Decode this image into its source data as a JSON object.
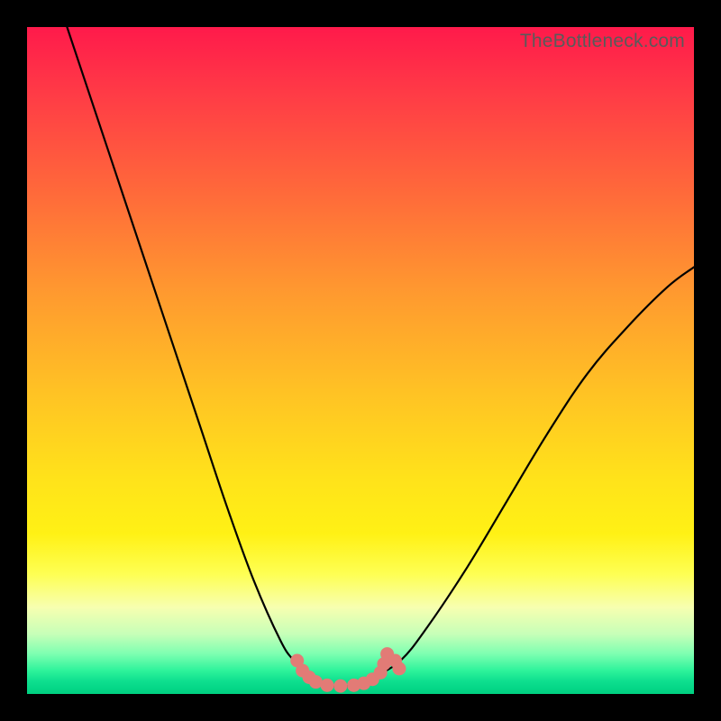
{
  "watermark": "TheBottleneck.com",
  "chart_data": {
    "type": "line",
    "title": "",
    "xlabel": "",
    "ylabel": "",
    "xlim": [
      0,
      100
    ],
    "ylim": [
      0,
      100
    ],
    "grid": false,
    "legend": false,
    "series": [
      {
        "name": "left-branch",
        "x": [
          6,
          10,
          14,
          18,
          22,
          26,
          30,
          34,
          38,
          40,
          42
        ],
        "values": [
          100,
          88,
          76,
          64,
          52,
          40,
          28,
          17,
          8,
          5,
          3
        ]
      },
      {
        "name": "trough",
        "x": [
          42,
          44,
          46,
          48,
          50,
          52
        ],
        "values": [
          3,
          1.5,
          1.2,
          1.2,
          1.5,
          2.5
        ]
      },
      {
        "name": "right-branch",
        "x": [
          52,
          56,
          60,
          66,
          72,
          78,
          84,
          90,
          96,
          100
        ],
        "values": [
          2.5,
          5,
          10,
          19,
          29,
          39,
          48,
          55,
          61,
          64
        ]
      }
    ],
    "trough_markers": {
      "name": "trough-dots",
      "x": [
        40.5,
        41.3,
        42.3,
        43.3,
        45,
        47,
        49,
        50.5,
        51.8,
        53,
        53.5,
        54.0,
        55.2,
        55.8
      ],
      "values": [
        5.0,
        3.5,
        2.5,
        1.8,
        1.3,
        1.2,
        1.3,
        1.6,
        2.2,
        3.2,
        4.5,
        6.0,
        5.0,
        3.8
      ]
    },
    "background_gradient": {
      "top": "#ff1a4b",
      "upper_mid": "#ffa829",
      "lower_mid": "#fff030",
      "bottom": "#00cf80"
    }
  }
}
